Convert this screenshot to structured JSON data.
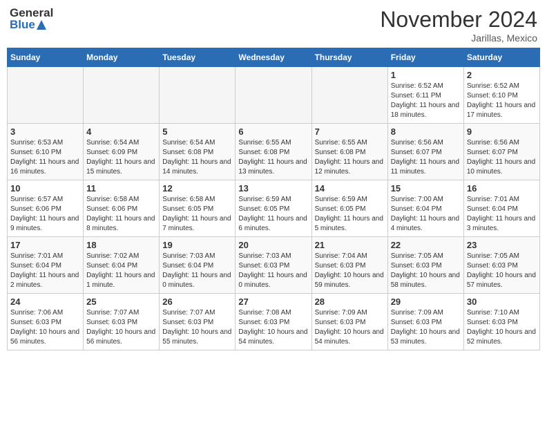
{
  "header": {
    "logo_line1": "General",
    "logo_line2": "Blue",
    "month_title": "November 2024",
    "location": "Jarillas, Mexico"
  },
  "days_of_week": [
    "Sunday",
    "Monday",
    "Tuesday",
    "Wednesday",
    "Thursday",
    "Friday",
    "Saturday"
  ],
  "weeks": [
    [
      {
        "day": "",
        "info": ""
      },
      {
        "day": "",
        "info": ""
      },
      {
        "day": "",
        "info": ""
      },
      {
        "day": "",
        "info": ""
      },
      {
        "day": "",
        "info": ""
      },
      {
        "day": "1",
        "info": "Sunrise: 6:52 AM\nSunset: 6:11 PM\nDaylight: 11 hours and 18 minutes."
      },
      {
        "day": "2",
        "info": "Sunrise: 6:52 AM\nSunset: 6:10 PM\nDaylight: 11 hours and 17 minutes."
      }
    ],
    [
      {
        "day": "3",
        "info": "Sunrise: 6:53 AM\nSunset: 6:10 PM\nDaylight: 11 hours and 16 minutes."
      },
      {
        "day": "4",
        "info": "Sunrise: 6:54 AM\nSunset: 6:09 PM\nDaylight: 11 hours and 15 minutes."
      },
      {
        "day": "5",
        "info": "Sunrise: 6:54 AM\nSunset: 6:08 PM\nDaylight: 11 hours and 14 minutes."
      },
      {
        "day": "6",
        "info": "Sunrise: 6:55 AM\nSunset: 6:08 PM\nDaylight: 11 hours and 13 minutes."
      },
      {
        "day": "7",
        "info": "Sunrise: 6:55 AM\nSunset: 6:08 PM\nDaylight: 11 hours and 12 minutes."
      },
      {
        "day": "8",
        "info": "Sunrise: 6:56 AM\nSunset: 6:07 PM\nDaylight: 11 hours and 11 minutes."
      },
      {
        "day": "9",
        "info": "Sunrise: 6:56 AM\nSunset: 6:07 PM\nDaylight: 11 hours and 10 minutes."
      }
    ],
    [
      {
        "day": "10",
        "info": "Sunrise: 6:57 AM\nSunset: 6:06 PM\nDaylight: 11 hours and 9 minutes."
      },
      {
        "day": "11",
        "info": "Sunrise: 6:58 AM\nSunset: 6:06 PM\nDaylight: 11 hours and 8 minutes."
      },
      {
        "day": "12",
        "info": "Sunrise: 6:58 AM\nSunset: 6:05 PM\nDaylight: 11 hours and 7 minutes."
      },
      {
        "day": "13",
        "info": "Sunrise: 6:59 AM\nSunset: 6:05 PM\nDaylight: 11 hours and 6 minutes."
      },
      {
        "day": "14",
        "info": "Sunrise: 6:59 AM\nSunset: 6:05 PM\nDaylight: 11 hours and 5 minutes."
      },
      {
        "day": "15",
        "info": "Sunrise: 7:00 AM\nSunset: 6:04 PM\nDaylight: 11 hours and 4 minutes."
      },
      {
        "day": "16",
        "info": "Sunrise: 7:01 AM\nSunset: 6:04 PM\nDaylight: 11 hours and 3 minutes."
      }
    ],
    [
      {
        "day": "17",
        "info": "Sunrise: 7:01 AM\nSunset: 6:04 PM\nDaylight: 11 hours and 2 minutes."
      },
      {
        "day": "18",
        "info": "Sunrise: 7:02 AM\nSunset: 6:04 PM\nDaylight: 11 hours and 1 minute."
      },
      {
        "day": "19",
        "info": "Sunrise: 7:03 AM\nSunset: 6:04 PM\nDaylight: 11 hours and 0 minutes."
      },
      {
        "day": "20",
        "info": "Sunrise: 7:03 AM\nSunset: 6:03 PM\nDaylight: 11 hours and 0 minutes."
      },
      {
        "day": "21",
        "info": "Sunrise: 7:04 AM\nSunset: 6:03 PM\nDaylight: 10 hours and 59 minutes."
      },
      {
        "day": "22",
        "info": "Sunrise: 7:05 AM\nSunset: 6:03 PM\nDaylight: 10 hours and 58 minutes."
      },
      {
        "day": "23",
        "info": "Sunrise: 7:05 AM\nSunset: 6:03 PM\nDaylight: 10 hours and 57 minutes."
      }
    ],
    [
      {
        "day": "24",
        "info": "Sunrise: 7:06 AM\nSunset: 6:03 PM\nDaylight: 10 hours and 56 minutes."
      },
      {
        "day": "25",
        "info": "Sunrise: 7:07 AM\nSunset: 6:03 PM\nDaylight: 10 hours and 56 minutes."
      },
      {
        "day": "26",
        "info": "Sunrise: 7:07 AM\nSunset: 6:03 PM\nDaylight: 10 hours and 55 minutes."
      },
      {
        "day": "27",
        "info": "Sunrise: 7:08 AM\nSunset: 6:03 PM\nDaylight: 10 hours and 54 minutes."
      },
      {
        "day": "28",
        "info": "Sunrise: 7:09 AM\nSunset: 6:03 PM\nDaylight: 10 hours and 54 minutes."
      },
      {
        "day": "29",
        "info": "Sunrise: 7:09 AM\nSunset: 6:03 PM\nDaylight: 10 hours and 53 minutes."
      },
      {
        "day": "30",
        "info": "Sunrise: 7:10 AM\nSunset: 6:03 PM\nDaylight: 10 hours and 52 minutes."
      }
    ]
  ]
}
